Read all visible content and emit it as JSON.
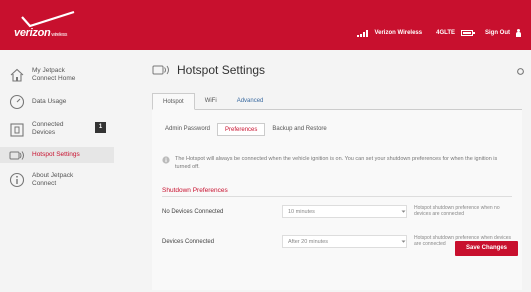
{
  "header": {
    "brand": "verizon",
    "brand_sub": "wireless",
    "network": "Verizon Wireless",
    "network_type": "4GLTE",
    "signout_label": "Sign Out",
    "accent_color": "#c8102e"
  },
  "sidebar": {
    "items": [
      {
        "label": "My Jetpack Connect Home",
        "icon": "home-icon"
      },
      {
        "label": "Data Usage",
        "icon": "gauge-icon"
      },
      {
        "label": "Connected Devices",
        "icon": "devices-icon",
        "badge": "1"
      },
      {
        "label": "Hotspot Settings",
        "icon": "hotspot-icon",
        "active": true
      },
      {
        "label": "About Jetpack Connect",
        "icon": "info-icon"
      }
    ]
  },
  "main": {
    "title": "Hotspot Settings",
    "tabs": [
      {
        "label": "Hotspot",
        "active": true
      },
      {
        "label": "WiFi"
      },
      {
        "label": "Advanced"
      }
    ],
    "subtabs": [
      {
        "label": "Admin Password"
      },
      {
        "label": "Preferences",
        "active": true
      },
      {
        "label": "Backup and Restore"
      }
    ],
    "info_text": "The Hotspot will always be connected when the vehicle ignition is on. You can set your shutdown preferences for when the ignition is turned off.",
    "section_title": "Shutdown Preferences",
    "rows": [
      {
        "label": "No Devices Connected",
        "value": "10 minutes",
        "help": "Hotspot shutdown preference when no devices are connected"
      },
      {
        "label": "Devices Connected",
        "value": "After 20 minutes",
        "help": "Hotspot shutdown preference when devices are connected"
      }
    ],
    "save_label": "Save Changes"
  }
}
